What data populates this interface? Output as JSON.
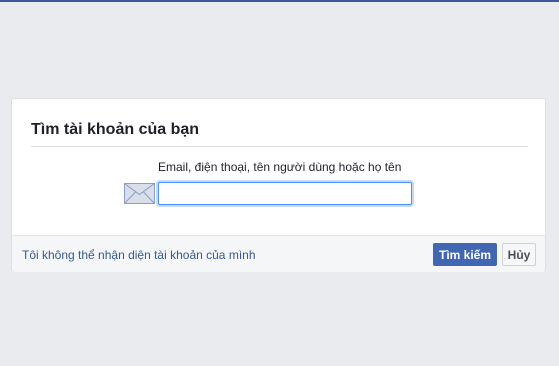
{
  "dialog": {
    "title": "Tìm tài khoản của bạn",
    "field_label": "Email, điện thoại, tên người dùng hoặc họ tên",
    "input_value": "",
    "input_placeholder": "",
    "icon": "mail-envelope-icon"
  },
  "footer": {
    "cant_identify_link": "Tôi không thể nhận diện tài khoản của mình",
    "search_label": "Tìm kiếm",
    "cancel_label": "Hủy"
  },
  "colors": {
    "page_background": "#e9ebee",
    "brand_blue": "#4267b2",
    "link_blue": "#365899",
    "input_focus_border": "#4d90fe"
  }
}
